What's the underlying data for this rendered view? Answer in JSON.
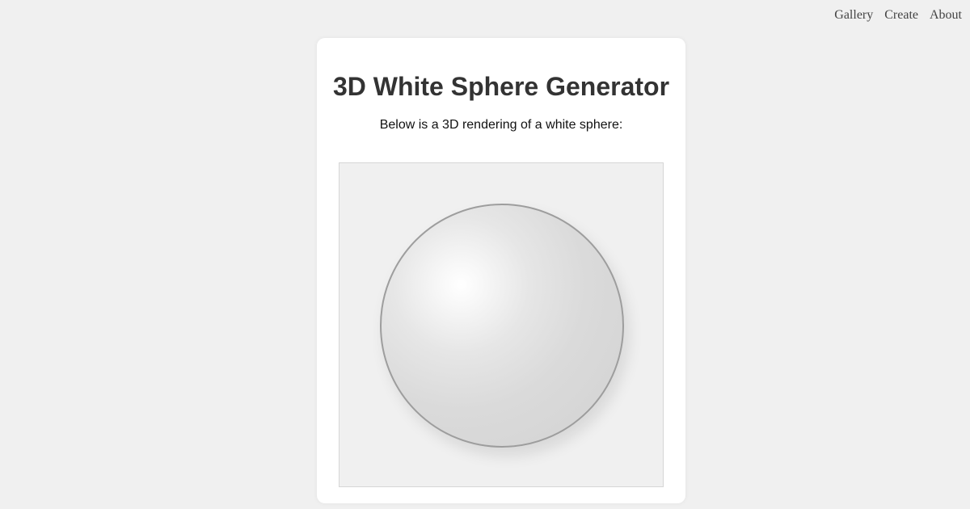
{
  "nav": {
    "items": [
      "Gallery",
      "Create",
      "About"
    ]
  },
  "card": {
    "title": "3D White Sphere Generator",
    "subtitle": "Below is a 3D rendering of a white sphere:"
  },
  "sphere": {
    "color": "#ffffff",
    "outline_color": "#9d9d9d",
    "viewport_background": "#f0f0f0"
  }
}
